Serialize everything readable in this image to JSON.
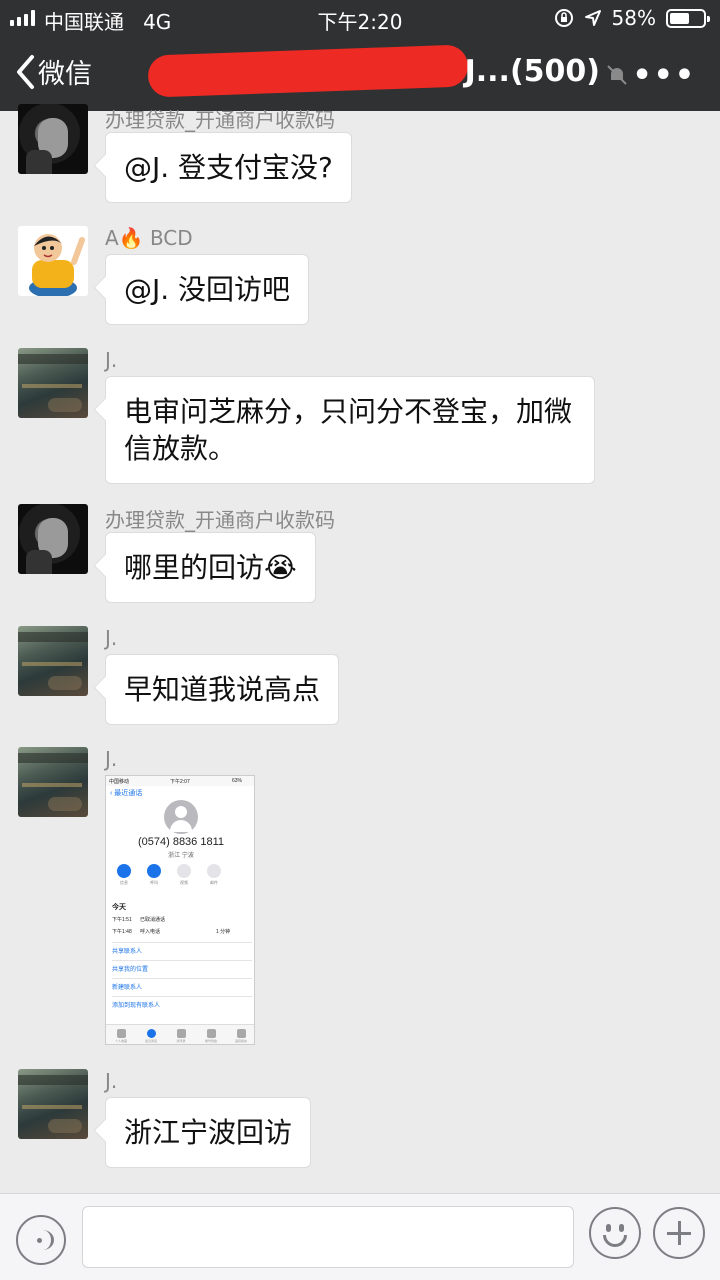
{
  "status_bar": {
    "carrier": "中国联通",
    "network": "4G",
    "time": "下午2:20",
    "battery": "58%",
    "battery_level": 0.58
  },
  "nav": {
    "back_label": "微信",
    "title": "J...(500)",
    "muted": true,
    "more_label": "•••"
  },
  "messages": [
    {
      "sender": "办理贷款_开通商户收款码",
      "text": "@J. 登支付宝没?",
      "avatar": "dark-portrait"
    },
    {
      "sender": "A🔥 BCD",
      "text": "@J. 没回访吧",
      "avatar": "cartoon"
    },
    {
      "sender": "J.",
      "text": "电审问芝麻分，只问分不登宝，加微信放款。",
      "avatar": "city"
    },
    {
      "sender": "办理贷款_开通商户收款码",
      "text": "哪里的回访😭",
      "avatar": "dark-portrait"
    },
    {
      "sender": "J.",
      "text": "早知道我说高点",
      "avatar": "city"
    },
    {
      "sender": "J.",
      "type": "image",
      "avatar": "city"
    },
    {
      "sender": "J.",
      "text": "浙江宁波回访",
      "avatar": "city"
    }
  ],
  "screenshot": {
    "carrier": "中国移动",
    "time": "下午2:07",
    "battery": "63%",
    "back_label": "最近通话",
    "phone": "(0574) 8836 1811",
    "location": "浙江 宁波",
    "actions": [
      "信息",
      "呼叫",
      "视频",
      "邮件"
    ],
    "today_label": "今天",
    "calls": [
      {
        "time": "下午1:51",
        "type": "已取消通话",
        "duration": ""
      },
      {
        "time": "下午1:48",
        "type": "呼入电话",
        "duration": "1 分钟"
      }
    ],
    "links": [
      "共享联系人",
      "共享我的位置",
      "新建联系人",
      "添加到现有联系人"
    ],
    "tabs": [
      "个人收藏",
      "最近通话",
      "通讯录",
      "拨号键盘",
      "语音留言"
    ]
  },
  "colors": {
    "nav_bg": "#303133",
    "chat_bg": "#ebebeb",
    "redaction": "#ee2a24",
    "ios_blue": "#1a73e8"
  }
}
